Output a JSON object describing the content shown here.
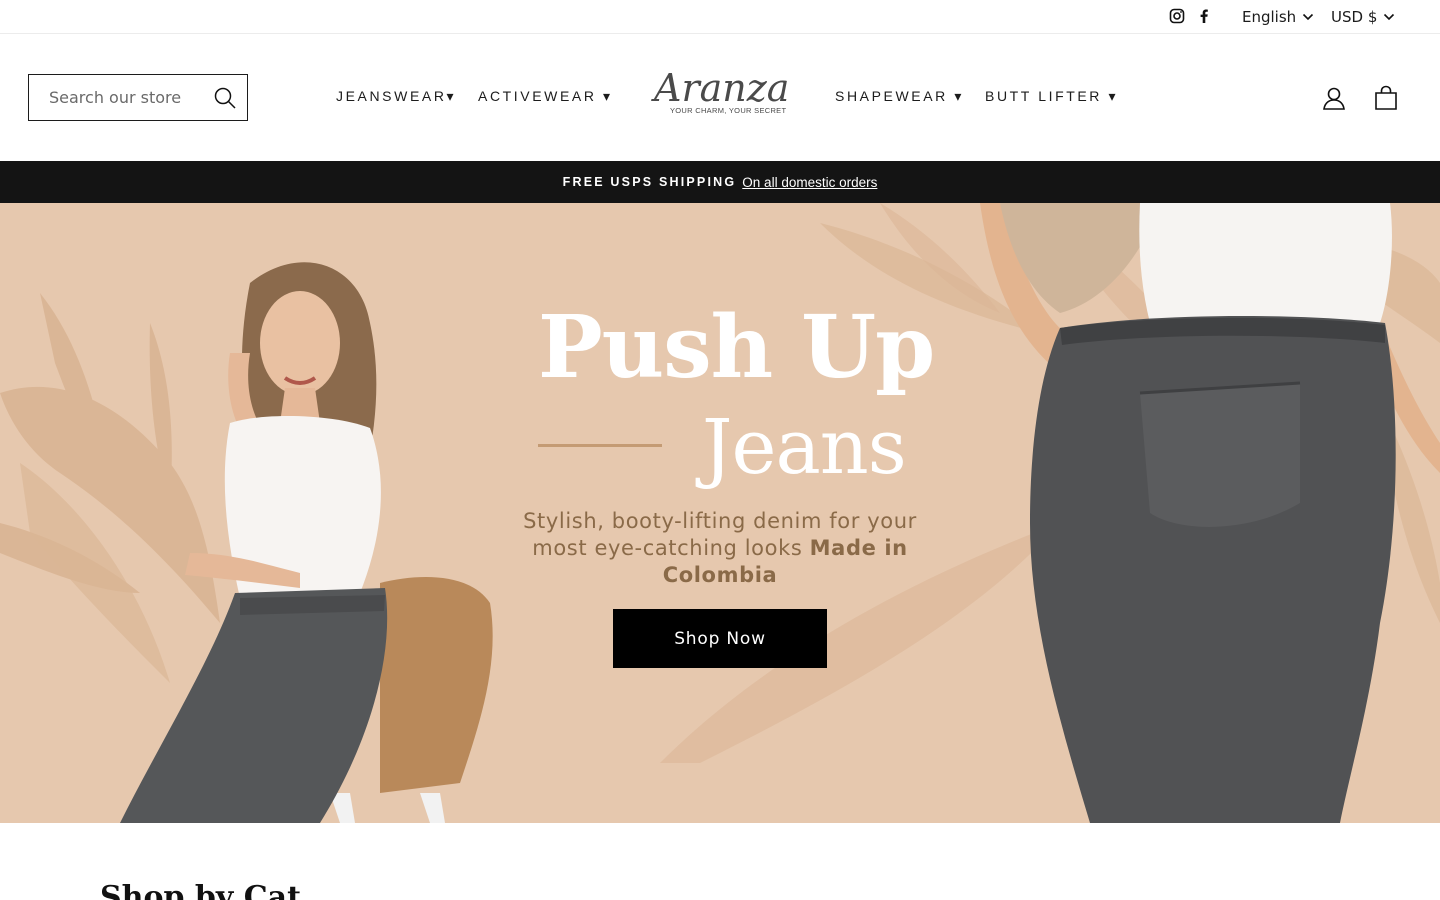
{
  "utility": {
    "language": "English",
    "currency": "USD $",
    "social": [
      "instagram-icon",
      "facebook-icon"
    ]
  },
  "header": {
    "search_placeholder": "Search our store",
    "nav_left": [
      "JEANSWEAR▾",
      "ACTIVEWEAR ▾"
    ],
    "nav_right": [
      "SHAPEWEAR ▾",
      "BUTT LIFTER ▾"
    ],
    "logo_text": "Aranza",
    "logo_tagline": "YOUR CHARM, YOUR SECRET",
    "icons": [
      "account-icon",
      "cart-icon"
    ]
  },
  "announcement": {
    "strong": "FREE USPS SHIPPING",
    "link": "On all domestic orders"
  },
  "hero": {
    "title_line1": "Push Up",
    "title_line2": "Jeans",
    "subtitle_pre": "Stylish, booty-lifting denim for your most eye-catching looks ",
    "subtitle_bold": "Made in Colombia",
    "cta": "Shop Now"
  },
  "below": {
    "heading": "Shop by Cat"
  },
  "colors": {
    "hero_bg": "#e6c8ae",
    "accent_brown": "#8a6a48",
    "announce_bg": "#141414"
  }
}
